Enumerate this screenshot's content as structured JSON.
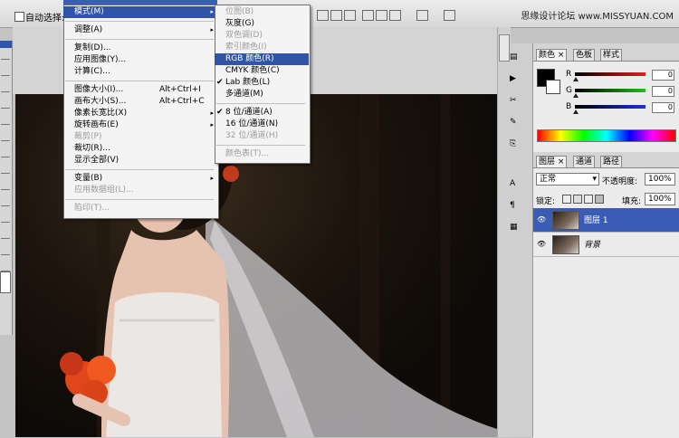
{
  "toolbar": {
    "auto_select_label": "自动选择:",
    "watermark": "思缘设计论坛  www.MISSYUAN.COM"
  },
  "image_menu": {
    "items": [
      {
        "label": "模式(M)",
        "arrow": "▸",
        "highlight": true
      },
      {
        "label": "调整(A)",
        "arrow": "▸"
      },
      {
        "label": "复制(D)..."
      },
      {
        "label": "应用图像(Y)..."
      },
      {
        "label": "计算(C)..."
      },
      {
        "label": "图像大小(I)...",
        "shortcut": "Alt+Ctrl+I"
      },
      {
        "label": "画布大小(S)...",
        "shortcut": "Alt+Ctrl+C"
      },
      {
        "label": "像素长宽比(X)",
        "arrow": "▸"
      },
      {
        "label": "旋转画布(E)",
        "arrow": "▸"
      },
      {
        "label": "裁剪(P)",
        "disabled": true
      },
      {
        "label": "裁切(R)..."
      },
      {
        "label": "显示全部(V)"
      },
      {
        "label": "变量(B)",
        "arrow": "▸"
      },
      {
        "label": "应用数据组(L)...",
        "disabled": true
      },
      {
        "label": "陷印(T)...",
        "disabled": true
      }
    ]
  },
  "mode_submenu": {
    "items": [
      {
        "label": "位图(B)",
        "disabled": true
      },
      {
        "label": "灰度(G)"
      },
      {
        "label": "双色调(D)",
        "disabled": true
      },
      {
        "label": "索引颜色(I)",
        "disabled": true
      },
      {
        "label": "RGB 颜色(R)",
        "highlight": true
      },
      {
        "label": "CMYK 颜色(C)"
      },
      {
        "label": "Lab 颜色(L)",
        "check": "✔"
      },
      {
        "label": "多通道(M)"
      },
      {
        "label": "8 位/通道(A)",
        "check": "✔"
      },
      {
        "label": "16 位/通道(N)"
      },
      {
        "label": "32 位/通道(H)",
        "disabled": true
      },
      {
        "label": "颜色表(T)...",
        "disabled": true
      }
    ]
  },
  "color_panel": {
    "tabs": [
      "颜色",
      "色板",
      "样式"
    ],
    "close_glyph": "×",
    "channels": [
      {
        "name": "R",
        "color": "#e02020",
        "value": 0.0
      },
      {
        "name": "G",
        "color": "#20c020",
        "value": 0.0
      },
      {
        "name": "B",
        "color": "#2030e0",
        "value": 0.0
      }
    ],
    "values": [
      "0",
      "0",
      "0"
    ]
  },
  "layers_panel": {
    "tabs": [
      "图层",
      "通道",
      "路径"
    ],
    "close_glyph": "×",
    "blend_mode": "正常",
    "opacity_label": "不透明度:",
    "opacity_value": "100%",
    "lock_label": "锁定:",
    "fill_label": "填充:",
    "fill_value": "100%",
    "layers": [
      {
        "name": "图层 1",
        "selected": true
      },
      {
        "name": "背景",
        "selected": false
      }
    ]
  },
  "dock_icons": [
    "history-icon",
    "actions-icon",
    "tool-presets-icon",
    "brushes-icon",
    "clone-source-icon",
    "character-icon",
    "paragraph-icon",
    "layer-comps-icon"
  ],
  "colors": {
    "menu_highlight": "#2f54a8",
    "layer_selected": "#3a5cb4"
  }
}
